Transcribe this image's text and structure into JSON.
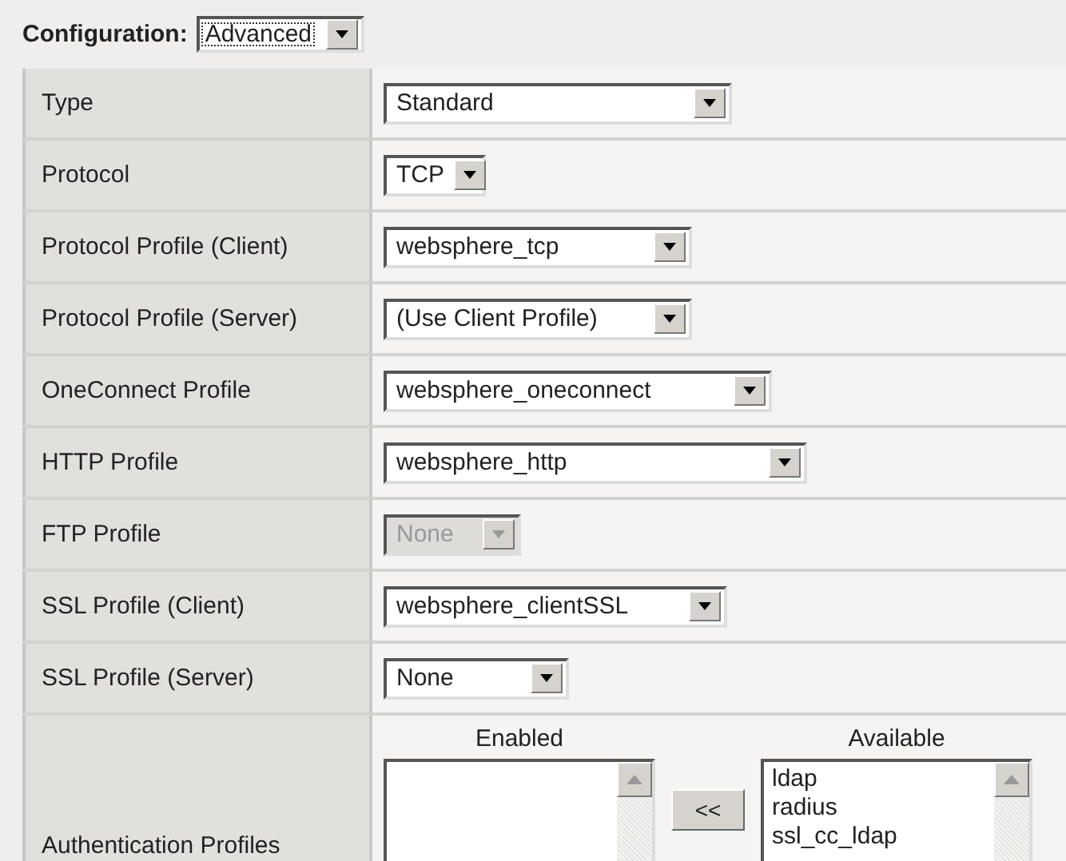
{
  "configuration": {
    "label": "Configuration:",
    "value": "Advanced",
    "focused": true
  },
  "rows": [
    {
      "label": "Type",
      "kind": "select",
      "value": "Standard",
      "disabled": false
    },
    {
      "label": "Protocol",
      "kind": "select",
      "value": "TCP",
      "disabled": false
    },
    {
      "label": "Protocol Profile (Client)",
      "kind": "select",
      "value": "websphere_tcp",
      "disabled": false
    },
    {
      "label": "Protocol Profile (Server)",
      "kind": "select",
      "value": "(Use Client Profile)",
      "disabled": false
    },
    {
      "label": "OneConnect Profile",
      "kind": "select",
      "value": "websphere_oneconnect",
      "disabled": false
    },
    {
      "label": "HTTP Profile",
      "kind": "select",
      "value": "websphere_http",
      "disabled": false
    },
    {
      "label": "FTP Profile",
      "kind": "select",
      "value": "None",
      "disabled": true
    },
    {
      "label": "SSL Profile (Client)",
      "kind": "select",
      "value": "websphere_clientSSL",
      "disabled": false
    },
    {
      "label": "SSL Profile (Server)",
      "kind": "select",
      "value": "None",
      "disabled": false
    },
    {
      "label": "Authentication Profiles",
      "kind": "dual_list",
      "enabled_label": "Enabled",
      "available_label": "Available",
      "move_button": "<<",
      "available": [
        "ldap",
        "radius",
        "ssl_cc_ldap"
      ]
    }
  ]
}
